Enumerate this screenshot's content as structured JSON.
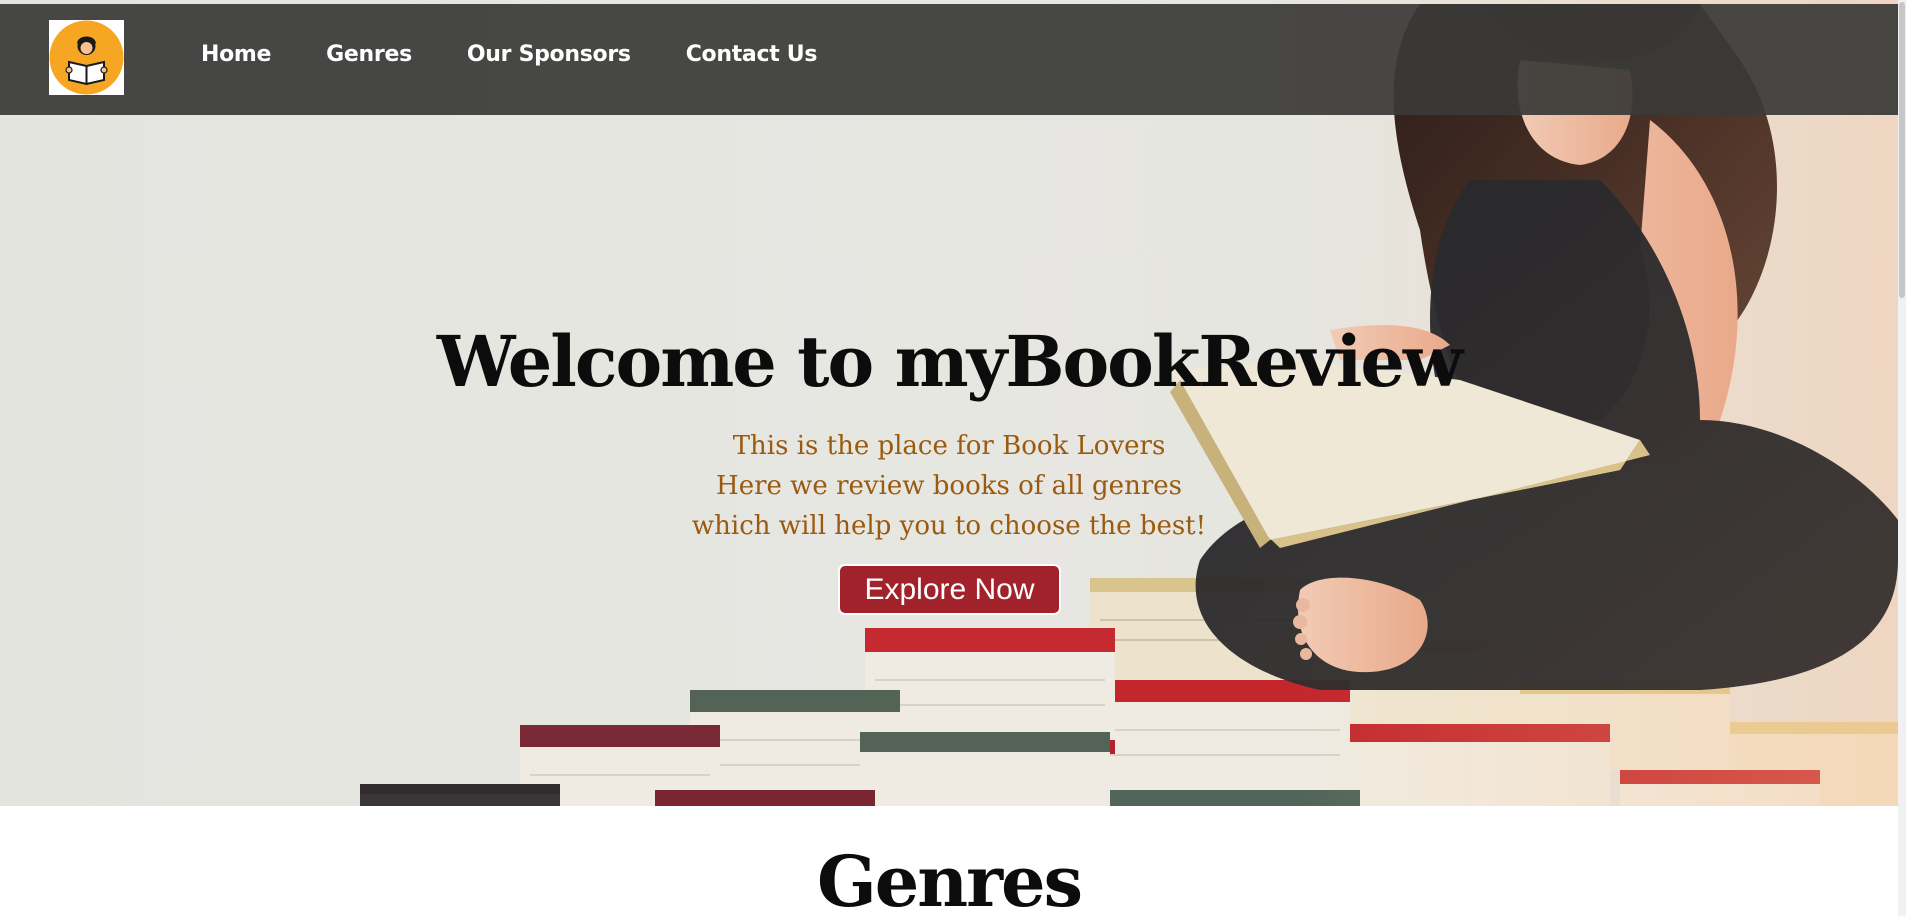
{
  "header": {
    "logo_icon": "reader-with-book-icon",
    "nav_items": [
      {
        "label": "Home"
      },
      {
        "label": "Genres"
      },
      {
        "label": "Our Sponsors"
      },
      {
        "label": "Contact Us"
      }
    ]
  },
  "hero": {
    "title": "Welcome to myBookReview",
    "subtitle_lines": [
      "This is the place for Book Lovers",
      "Here we review books of all genres",
      "which will help you to choose the best!"
    ],
    "cta_label": "Explore Now",
    "image": "girl-reading-on-stack-of-books"
  },
  "genres_section": {
    "title": "Genres"
  },
  "colors": {
    "nav_bg": "#3a3a38",
    "accent_button": "#a2222b",
    "subtitle_text": "#9a5a10",
    "logo_circle": "#f6a623"
  }
}
